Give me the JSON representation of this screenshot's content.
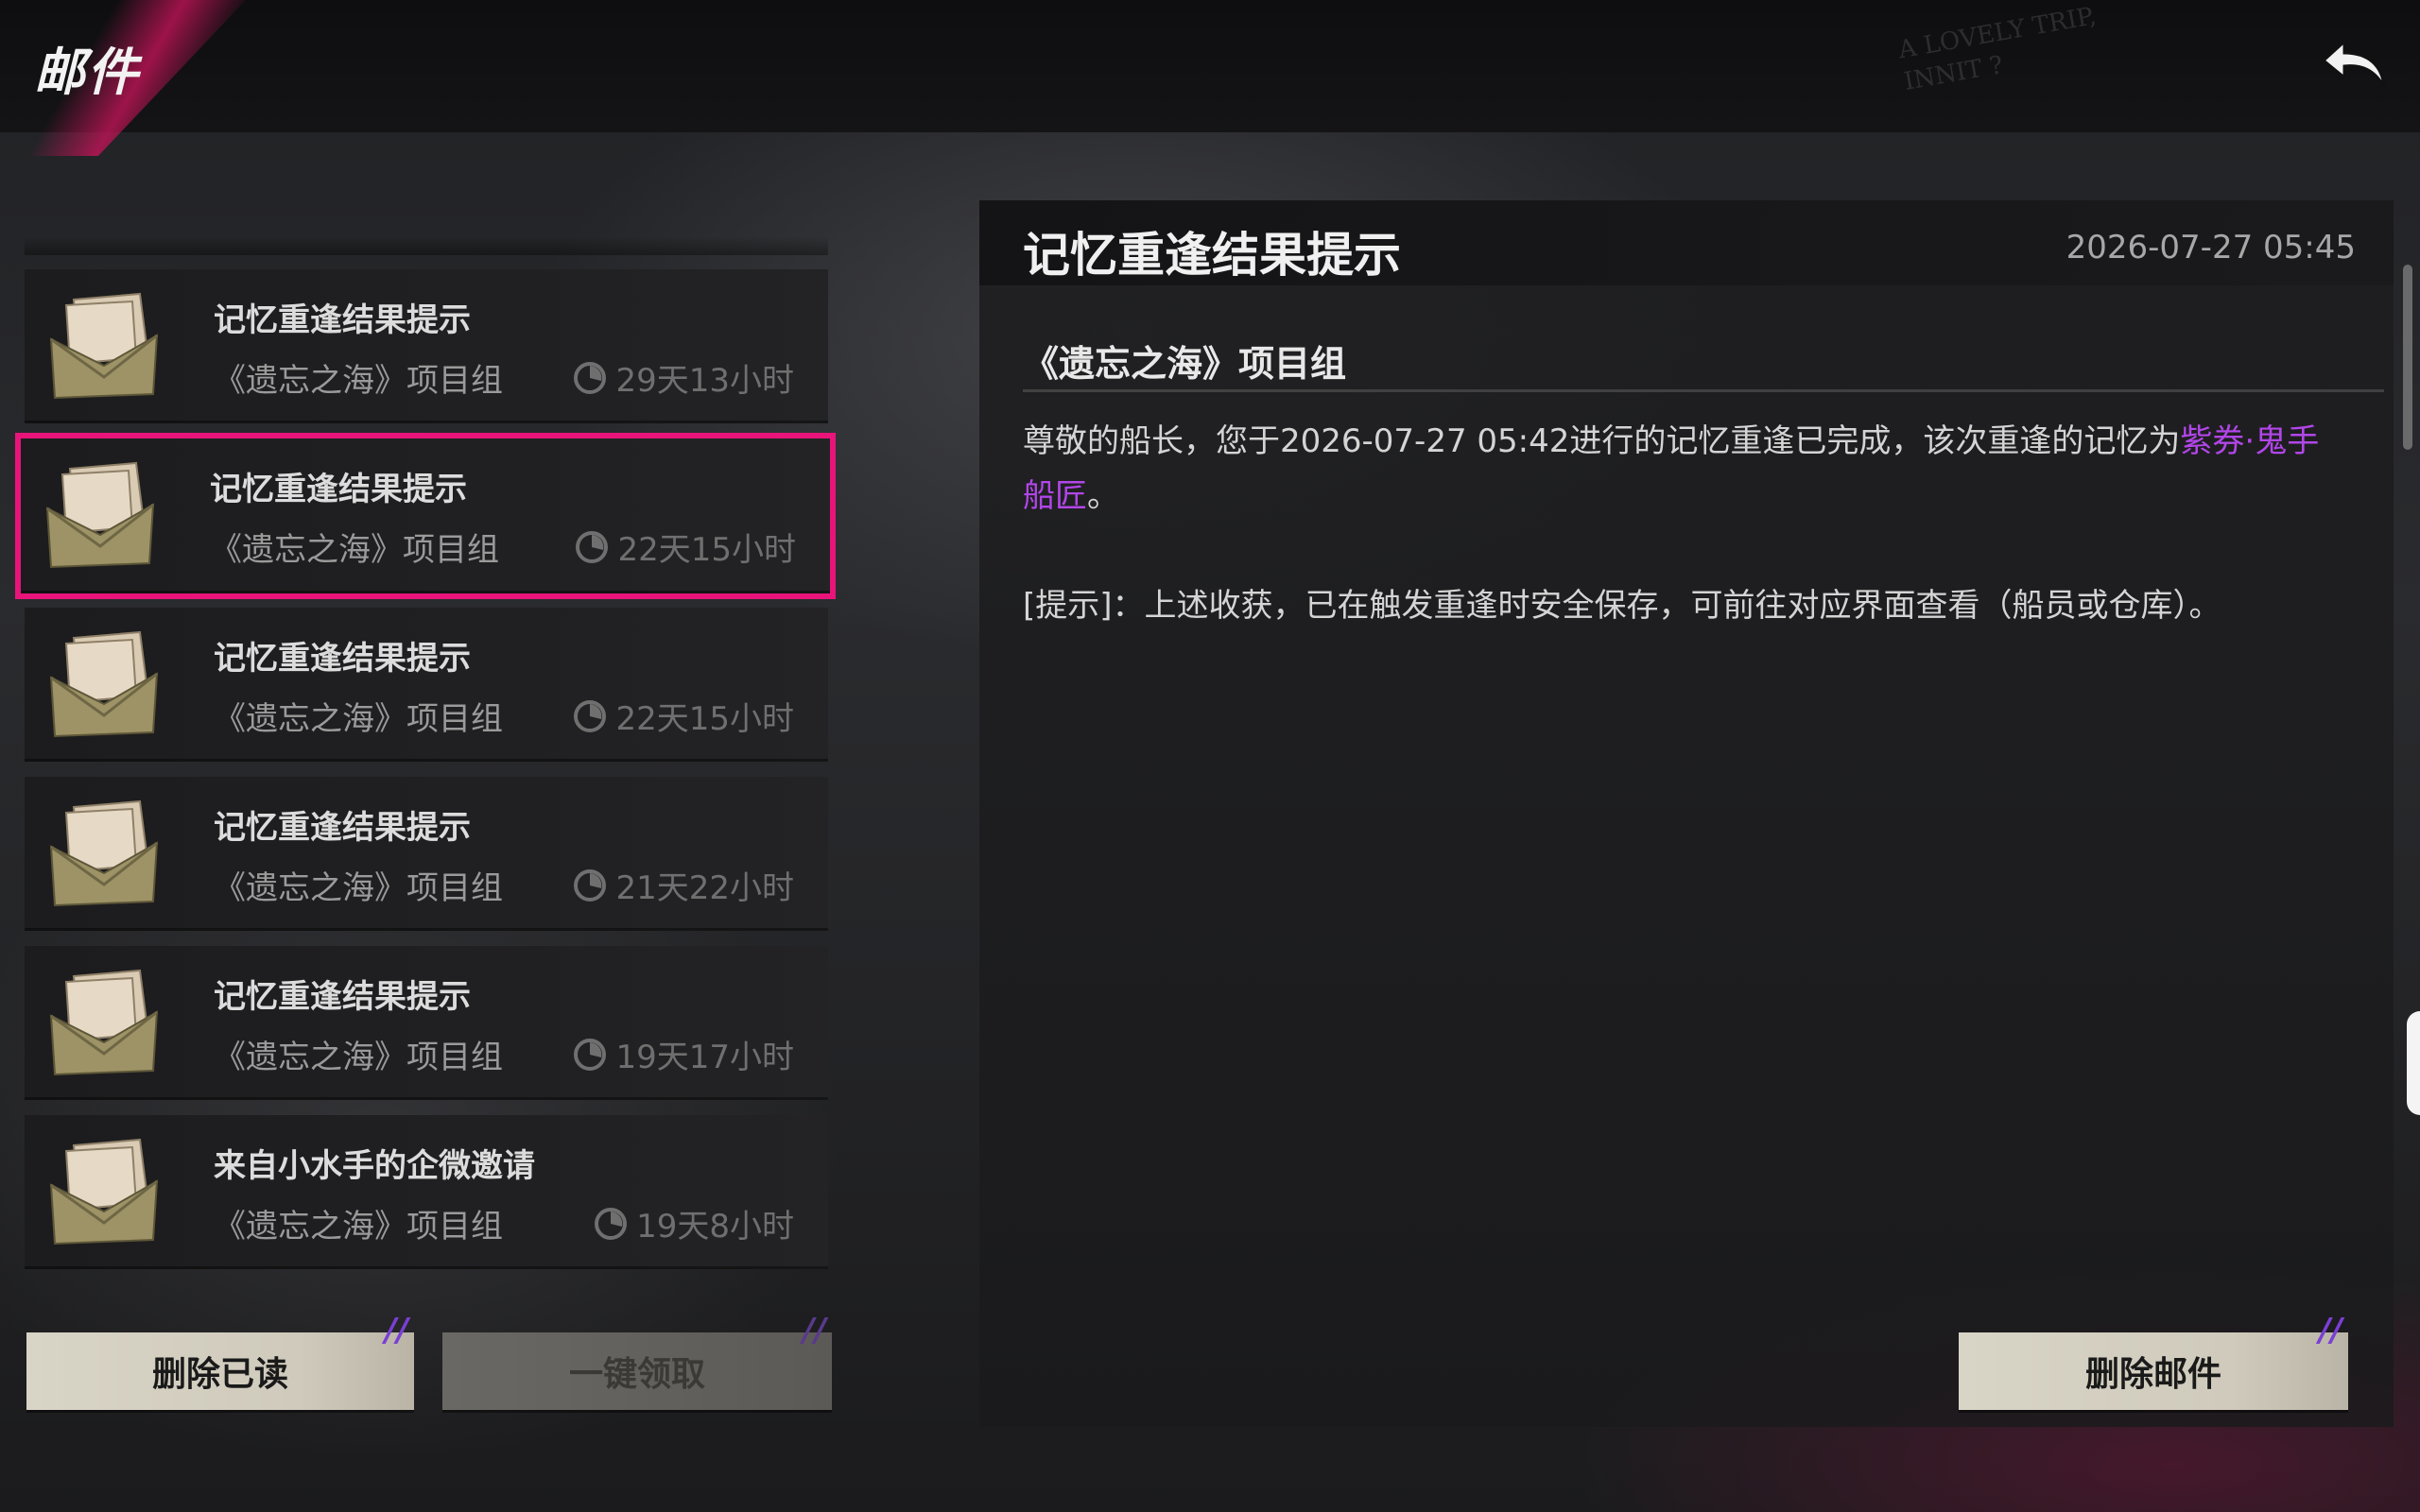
{
  "header": {
    "title": "邮件",
    "graffiti_line1": "A LOVELY TRIP,",
    "graffiti_line2": "INNIT ?"
  },
  "mail_list": [
    {
      "title": "记忆重逢结果提示",
      "sender": "《遗忘之海》项目组",
      "remaining": "29天13小时",
      "selected": false
    },
    {
      "title": "记忆重逢结果提示",
      "sender": "《遗忘之海》项目组",
      "remaining": "22天15小时",
      "selected": true
    },
    {
      "title": "记忆重逢结果提示",
      "sender": "《遗忘之海》项目组",
      "remaining": "22天15小时",
      "selected": false
    },
    {
      "title": "记忆重逢结果提示",
      "sender": "《遗忘之海》项目组",
      "remaining": "21天22小时",
      "selected": false
    },
    {
      "title": "记忆重逢结果提示",
      "sender": "《遗忘之海》项目组",
      "remaining": "19天17小时",
      "selected": false
    },
    {
      "title": "来自小水手的企微邀请",
      "sender": "《遗忘之海》项目组",
      "remaining": "19天8小时",
      "selected": false
    }
  ],
  "buttons": {
    "delete_read": "删除已读",
    "claim_all": "一键领取",
    "delete_mail": "删除邮件"
  },
  "detail": {
    "title": "记忆重逢结果提示",
    "date": "2026-07-27 05:45",
    "sender": "《遗忘之海》项目组",
    "body_prefix": "尊敬的船长，您于2026-07-27 05:42进行的记忆重逢已完成，该次重逢的记忆为",
    "body_highlight": "紫券·鬼手船匠",
    "body_suffix": "。",
    "tip": "[提示]：上述收获，已在触发重逢时安全保存，可前往对应界面查看（船员或仓库）。"
  },
  "colors": {
    "accent": "#e8147a",
    "highlight": "#b146e8",
    "button_bg": "#d8d4c6"
  },
  "icons": {
    "back": "back-arrow-icon",
    "mail": "envelope-icon",
    "timer": "clock-icon"
  }
}
